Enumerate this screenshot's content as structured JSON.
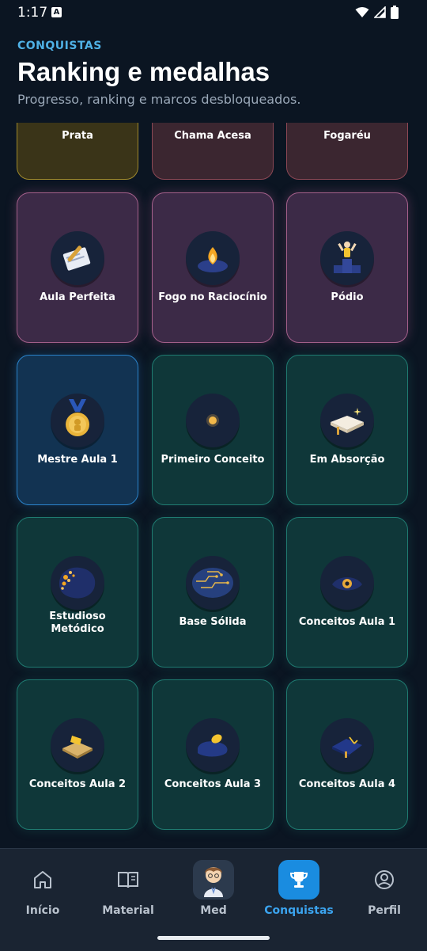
{
  "status_bar": {
    "time": "1:17",
    "sim_icon": "A"
  },
  "header": {
    "eyebrow": "CONQUISTAS",
    "title": "Ranking e medalhas",
    "subtitle": "Progresso, ranking e marcos desbloqueados."
  },
  "cards": [
    {
      "label": "Prata",
      "icon": "silver-medal-icon",
      "theme": "gold"
    },
    {
      "label": "Chama Acesa",
      "icon": "flame-icon",
      "theme": "red"
    },
    {
      "label": "Fogaréu",
      "icon": "bonfire-icon",
      "theme": "red"
    },
    {
      "label": "Aula Perfeita",
      "icon": "perfect-class-icon",
      "theme": "purple"
    },
    {
      "label": "Fogo no Raciocínio",
      "icon": "fire-mind-icon",
      "theme": "purple"
    },
    {
      "label": "Pódio",
      "icon": "podium-icon",
      "theme": "purple"
    },
    {
      "label": "Mestre Aula 1",
      "icon": "gold-medal-icon",
      "theme": "blue"
    },
    {
      "label": "Primeiro Conceito",
      "icon": "spark-icon",
      "theme": "teal"
    },
    {
      "label": "Em Absorção",
      "icon": "open-book-icon",
      "theme": "teal"
    },
    {
      "label": "Estudioso Metódico",
      "icon": "brain-icon",
      "theme": "teal"
    },
    {
      "label": "Base Sólida",
      "icon": "circuit-brain-icon",
      "theme": "teal"
    },
    {
      "label": "Conceitos Aula 1",
      "icon": "eye-icon",
      "theme": "teal"
    },
    {
      "label": "Conceitos Aula 2",
      "icon": "golden-book-icon",
      "theme": "teal"
    },
    {
      "label": "Conceitos Aula 3",
      "icon": "cushion-icon",
      "theme": "teal"
    },
    {
      "label": "Conceitos Aula 4",
      "icon": "pillow-icon",
      "theme": "teal"
    }
  ],
  "nav": {
    "items": [
      {
        "label": "Início",
        "icon": "home-icon"
      },
      {
        "label": "Material",
        "icon": "book-icon"
      },
      {
        "label": "Med",
        "icon": "avatar-icon"
      },
      {
        "label": "Conquistas",
        "icon": "trophy-icon"
      },
      {
        "label": "Perfil",
        "icon": "profile-icon"
      }
    ],
    "active": "Conquistas"
  },
  "colors": {
    "accent": "#1a8ce0",
    "background": "#0b1522",
    "eyebrow": "#4fb1e6"
  }
}
